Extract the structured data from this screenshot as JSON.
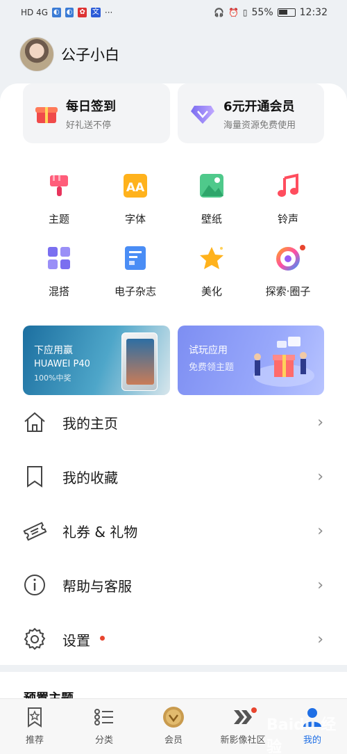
{
  "status_bar": {
    "left": "HD 4G",
    "battery": "55%",
    "time": "12:32"
  },
  "profile": {
    "username": "公子小白"
  },
  "cards": [
    {
      "title": "每日签到",
      "subtitle": "好礼送不停"
    },
    {
      "title": "6元开通会员",
      "subtitle": "海量资源免费使用"
    }
  ],
  "grid": [
    {
      "label": "主题",
      "icon": "brush-icon"
    },
    {
      "label": "字体",
      "icon": "font-icon"
    },
    {
      "label": "壁纸",
      "icon": "wallpaper-icon"
    },
    {
      "label": "铃声",
      "icon": "music-note-icon"
    },
    {
      "label": "混搭",
      "icon": "mix-grid-icon"
    },
    {
      "label": "电子杂志",
      "icon": "magazine-icon"
    },
    {
      "label": "美化",
      "icon": "star-icon"
    },
    {
      "label": "探索·圈子",
      "icon": "circle-explore-icon"
    }
  ],
  "banners": [
    {
      "line1": "下应用赢",
      "line2": "HUAWEI P40",
      "line3": "100%中奖"
    },
    {
      "line1": "试玩应用",
      "line2": "免费领主题"
    }
  ],
  "menu": [
    {
      "label": "我的主页",
      "icon": "home-icon"
    },
    {
      "label": "我的收藏",
      "icon": "bookmark-icon"
    },
    {
      "label": "礼券 & 礼物",
      "icon": "ticket-icon"
    },
    {
      "label": "帮助与客服",
      "icon": "info-icon"
    },
    {
      "label": "设置",
      "icon": "gear-icon"
    }
  ],
  "chevron": "›",
  "presets": {
    "title": "预置主题"
  },
  "tabs": [
    {
      "label": "推荐",
      "icon": "star-bookmark-icon"
    },
    {
      "label": "分类",
      "icon": "list-icon"
    },
    {
      "label": "会员",
      "icon": "vip-badge-icon"
    },
    {
      "label": "新影像社区",
      "icon": "chevrons-icon"
    },
    {
      "label": "我的",
      "icon": "user-icon"
    }
  ],
  "watermark": "Baidu 经验",
  "colors": {
    "accent": "#1f6fe5",
    "badge": "#e8452f"
  }
}
